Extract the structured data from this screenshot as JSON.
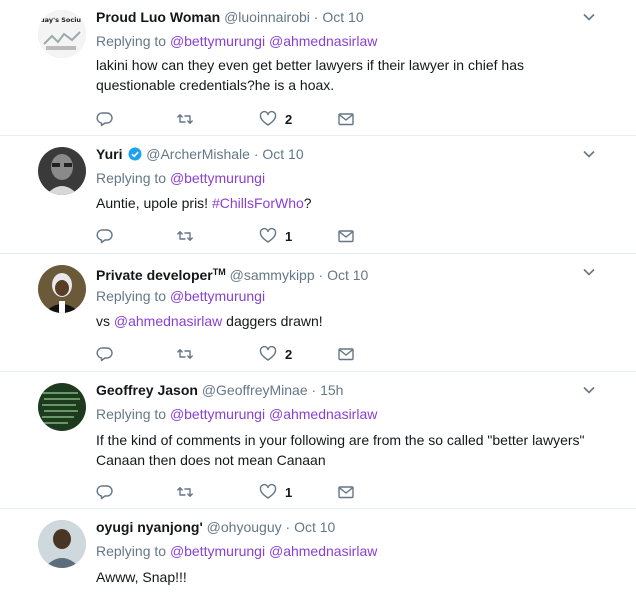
{
  "tweets": [
    {
      "name": "Proud Luo Woman",
      "handle": "@luoinnairobi",
      "dot": "·",
      "time": "Oct 10",
      "replying": "Replying to",
      "mentions": [
        "@bettymurungi",
        "@ahmednasirlaw"
      ],
      "text_lines": [
        "lakini how can they even get better lawyers if their lawyer in chief has",
        "questionable credentials?he is a hoax."
      ],
      "likes": "2",
      "avatar_text": "day's Sociu"
    },
    {
      "name": "Yuri",
      "handle": "@ArcherMishale",
      "dot": "·",
      "time": "Oct 10",
      "replying": "Replying to",
      "mentions": [
        "@bettymurungi"
      ],
      "text_before": "Auntie, upole pris! ",
      "hashtag": "#ChillsForWho",
      "text_after": "?",
      "likes": "1"
    },
    {
      "name": "Private developer",
      "tm": "TM",
      "handle": "@sammykipp",
      "dot": "·",
      "time": "Oct 10",
      "replying": "Replying to",
      "mentions": [
        "@bettymurungi"
      ],
      "text_before": "vs ",
      "inline_mention": "@ahmednasirlaw",
      "text_after": " daggers drawn!",
      "likes": "2"
    },
    {
      "name": "Geoffrey Jason",
      "handle": "@GeoffreyMinae",
      "dot": "·",
      "time": "15h",
      "replying": "Replying to",
      "mentions": [
        "@bettymurungi",
        "@ahmednasirlaw"
      ],
      "text_lines": [
        "If the kind of comments in your following are from the so called \"better lawyers\"",
        "Canaan then does not mean Canaan"
      ],
      "likes": "1"
    },
    {
      "name": "oyugi nyanjong'",
      "handle": "@ohyouguy",
      "dot": "·",
      "time": "Oct 10",
      "replying": "Replying to",
      "mentions": [
        "@bettymurungi",
        "@ahmednasirlaw"
      ],
      "text": "Awww, Snap!!!"
    }
  ],
  "icons": {
    "reply": "reply-icon",
    "retweet": "retweet-icon",
    "like": "heart-icon",
    "dm": "envelope-icon",
    "more": "chevron-down-icon",
    "verified": "verified-badge-icon"
  },
  "colors": {
    "mention": "#8b3fd1",
    "muted": "#657786",
    "icon": "#657786",
    "divider": "#e6ecf0",
    "verified": "#1da1f2"
  }
}
